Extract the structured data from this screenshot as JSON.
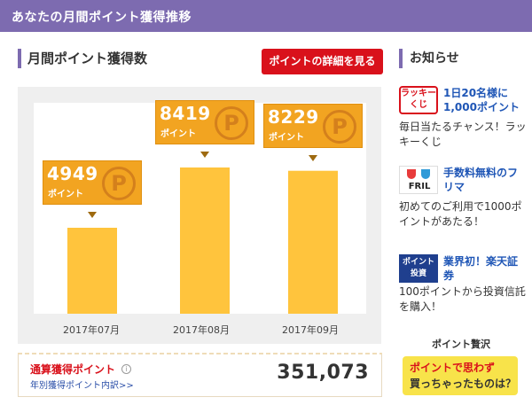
{
  "header": {
    "title": "あなたの月間ポイント獲得推移"
  },
  "section": {
    "title": "月間ポイント獲得数",
    "detail_button": "ポイントの詳細を見る"
  },
  "chart_data": {
    "type": "bar",
    "categories": [
      "2017年07月",
      "2017年08月",
      "2017年09月"
    ],
    "values": [
      4949,
      8419,
      8229
    ],
    "labels": [
      "4949",
      "8419",
      "8229"
    ],
    "unit": "ポイント",
    "ylim": [
      0,
      10000
    ],
    "grid": false,
    "bar_color": "#ffc43d",
    "callout_color": "#f2a421"
  },
  "coin_glyph": "P",
  "total": {
    "label": "通算獲得ポイント",
    "info_glyph": "i",
    "link": "年別獲得ポイント内訳>>",
    "value": "351,073"
  },
  "sidebar": {
    "title": "お知らせ",
    "items": [
      {
        "icon": "lucky-kuji-icon",
        "icon_text_1": "ラッキー",
        "icon_text_2": "くじ",
        "head": "1日20名様に1,000ポイント",
        "body": "毎日当たるチャンス！ラッキーくじ"
      },
      {
        "icon": "fril-icon",
        "icon_text_1": "FRIL",
        "head": "手数料無料のフリマ",
        "body": "初めてのご利用で1000ポイントがあたる！"
      },
      {
        "icon": "point-invest-icon",
        "icon_text_1": "ポイント",
        "icon_text_2": "投資",
        "head": "業界初！楽天証券",
        "body": "100ポイントから投資信託を購入！"
      }
    ],
    "banner": {
      "top": "ポイント贅沢",
      "line1": "ポイントで思わず",
      "line2": "買っちゃったものは？"
    }
  },
  "colors": {
    "header": "#7d6bb0",
    "accent_red": "#d9111b",
    "link_blue": "#1f56b6"
  }
}
